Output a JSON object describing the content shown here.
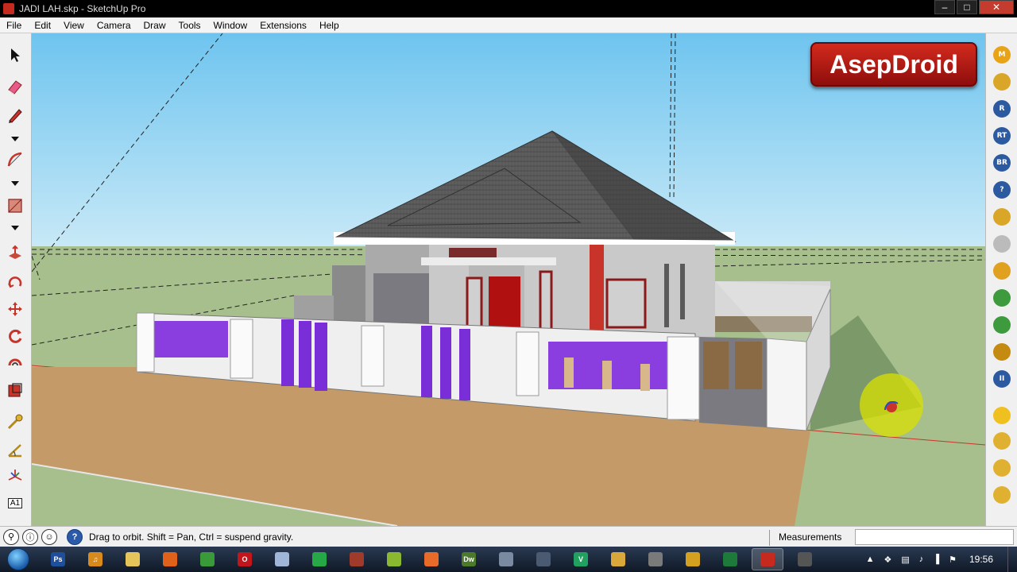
{
  "window": {
    "title": "JADI LAH.skp - SketchUp Pro",
    "controls": {
      "minimize": "–",
      "maximize": "□",
      "close": "✕"
    }
  },
  "menu": [
    "File",
    "Edit",
    "View",
    "Camera",
    "Draw",
    "Tools",
    "Window",
    "Extensions",
    "Help"
  ],
  "left_toolbar": {
    "tools": [
      "select-tool-icon",
      "eraser-tool-icon",
      "pencil-tool-icon",
      "arc-tool-icon",
      "rectangle-tool-icon",
      "push-pull-tool-icon",
      "orbit-tool-icon",
      "move-tool-icon",
      "rotate-tool-icon",
      "offset-tool-icon",
      "scale-tool-icon",
      "tape-measure-tool-icon",
      "protractor-tool-icon",
      "axes-tool-icon",
      "text-tool-icon"
    ],
    "text_tool_label": "A1"
  },
  "right_toolbar": {
    "buttons": [
      {
        "icon": "m-plugin-icon",
        "label": "M",
        "color": "#e8a317"
      },
      {
        "icon": "tag-plugin-icon",
        "label": "",
        "color": "#d9a628"
      },
      {
        "icon": "r-plugin-icon",
        "label": "R",
        "color": "#2c5aa0"
      },
      {
        "icon": "rt-plugin-icon",
        "label": "RT",
        "color": "#2c5aa0"
      },
      {
        "icon": "br-plugin-icon",
        "label": "BR",
        "color": "#2c5aa0"
      },
      {
        "icon": "help-plugin-icon",
        "label": "?",
        "color": "#2c5aa0"
      },
      {
        "icon": "tag-edit-plugin-icon",
        "label": "",
        "color": "#d9a628"
      },
      {
        "icon": "sphere-plugin-icon",
        "label": "",
        "color": "#bbbbbb"
      },
      {
        "icon": "arrows-plugin-icon",
        "label": "",
        "color": "#e0a020"
      },
      {
        "icon": "tree-plugin-icon",
        "label": "",
        "color": "#3d9a3d"
      },
      {
        "icon": "tree-alt-plugin-icon",
        "label": "",
        "color": "#3d9a3d"
      },
      {
        "icon": "target-plugin-icon",
        "label": "",
        "color": "#c58a10"
      },
      {
        "icon": "pause-plugin-icon",
        "label": "II",
        "color": "#2c5aa0"
      },
      {
        "icon": "ball-plugin-icon",
        "label": "",
        "color": "#f0c020"
      },
      {
        "icon": "plane-plugin-icon",
        "label": "",
        "color": "#e0b030"
      },
      {
        "icon": "flag-plugin-icon",
        "label": "",
        "color": "#e0b030"
      },
      {
        "icon": "dome-plugin-icon",
        "label": "",
        "color": "#e0b030"
      }
    ]
  },
  "brand": {
    "text": "AsepDroid"
  },
  "status": {
    "hint": "Drag to orbit. Shift = Pan, Ctrl = suspend gravity.",
    "measurements_label": "Measurements",
    "measurements_value": ""
  },
  "taskbar": {
    "apps": [
      {
        "icon": "photoshop-icon",
        "label": "Ps",
        "color": "#1e4f9c"
      },
      {
        "icon": "music-icon",
        "label": "♫",
        "color": "#d88a1a"
      },
      {
        "icon": "folder-icon",
        "label": "",
        "color": "#e6c45c"
      },
      {
        "icon": "firefox-icon",
        "label": "",
        "color": "#e0611a"
      },
      {
        "icon": "chrome-icon",
        "label": "",
        "color": "#3a9a3a"
      },
      {
        "icon": "opera-icon",
        "label": "O",
        "color": "#c0161c"
      },
      {
        "icon": "document-icon",
        "label": "",
        "color": "#9fb6d8"
      },
      {
        "icon": "download-manager-icon",
        "label": "",
        "color": "#27a846"
      },
      {
        "icon": "archive-icon",
        "label": "",
        "color": "#a03a2a"
      },
      {
        "icon": "android-icon",
        "label": "",
        "color": "#8ab830"
      },
      {
        "icon": "xampp-icon",
        "label": "",
        "color": "#e86b2a"
      },
      {
        "icon": "dreamweaver-icon",
        "label": "Dw",
        "color": "#4a7a2a"
      },
      {
        "icon": "image-viewer-icon",
        "label": "",
        "color": "#7a8aa0"
      },
      {
        "icon": "blackberry-icon",
        "label": "",
        "color": "#4a5a70"
      },
      {
        "icon": "vine-icon",
        "label": "V",
        "color": "#21a060"
      },
      {
        "icon": "folder-lock-icon",
        "label": "",
        "color": "#d8a83a"
      },
      {
        "icon": "tool-icon",
        "label": "",
        "color": "#7a7a7a"
      },
      {
        "icon": "layout-icon",
        "label": "",
        "color": "#d4a020"
      },
      {
        "icon": "excel-icon",
        "label": "",
        "color": "#1e7a3a"
      },
      {
        "icon": "sketchup-icon",
        "label": "",
        "color": "#c62a1e",
        "active": true
      },
      {
        "icon": "taskbar-misc-icon",
        "label": "",
        "color": "#555555"
      }
    ],
    "tray": {
      "icons": [
        "show-hidden-icon",
        "dropbox-icon",
        "network-icon",
        "volume-icon",
        "signal-icon",
        "flag-icon"
      ],
      "clock": "19:56"
    }
  }
}
